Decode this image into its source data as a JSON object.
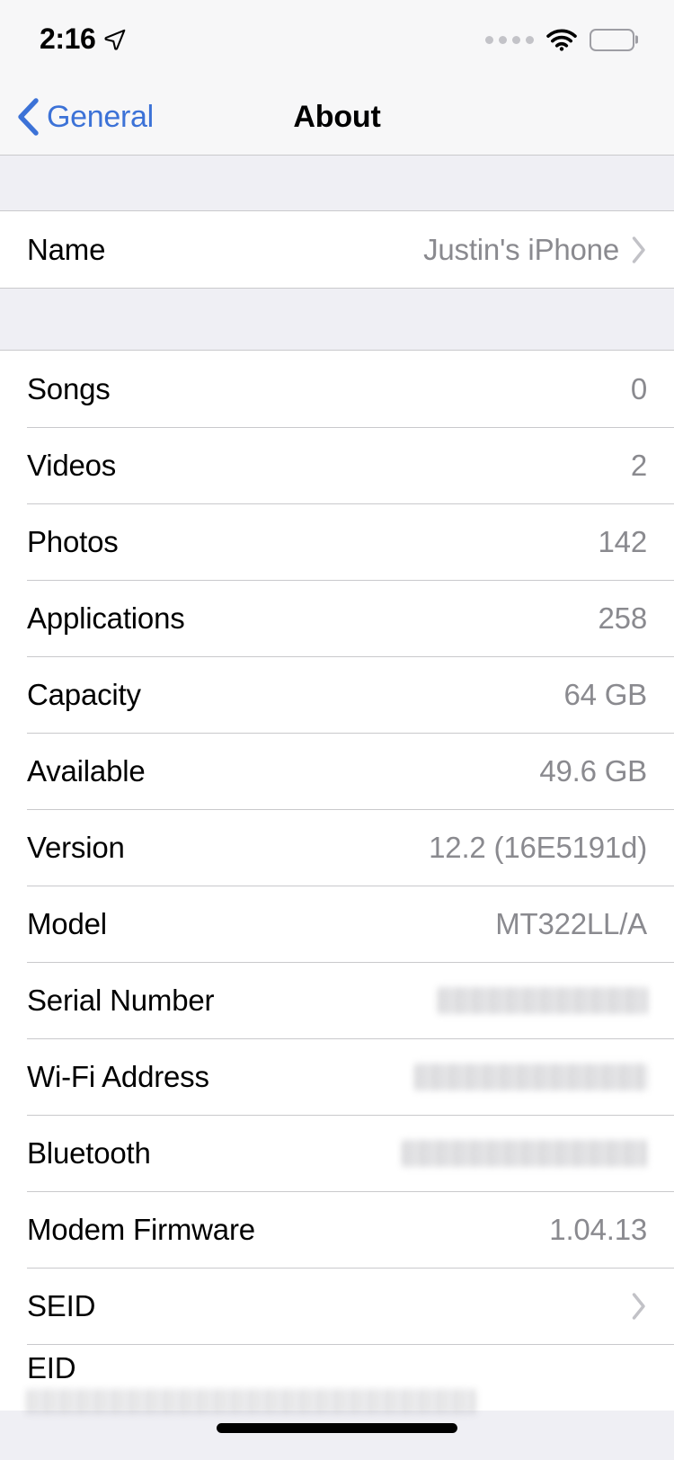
{
  "status_bar": {
    "time": "2:16",
    "location_icon": "location-arrow-icon",
    "signal_icon": "signal-dots-icon",
    "wifi_icon": "wifi-icon",
    "battery_icon": "battery-low-power-icon",
    "battery_color": "#F8CF47"
  },
  "nav": {
    "back_label": "General",
    "title": "About",
    "accent_color": "#3C72D7"
  },
  "sections": [
    {
      "rows": [
        {
          "label": "Name",
          "value": "Justin's iPhone",
          "chevron": true
        }
      ]
    },
    {
      "rows": [
        {
          "label": "Songs",
          "value": "0"
        },
        {
          "label": "Videos",
          "value": "2"
        },
        {
          "label": "Photos",
          "value": "142"
        },
        {
          "label": "Applications",
          "value": "258"
        },
        {
          "label": "Capacity",
          "value": "64 GB"
        },
        {
          "label": "Available",
          "value": "49.6 GB"
        },
        {
          "label": "Version",
          "value": "12.2 (16E5191d)"
        },
        {
          "label": "Model",
          "value": "MT322LL/A"
        },
        {
          "label": "Serial Number",
          "value": "",
          "redacted": true
        },
        {
          "label": "Wi-Fi Address",
          "value": "",
          "redacted": true
        },
        {
          "label": "Bluetooth",
          "value": "",
          "redacted": true
        },
        {
          "label": "Modem Firmware",
          "value": "1.04.13"
        },
        {
          "label": "SEID",
          "value": "",
          "chevron": true
        },
        {
          "label": "EID",
          "value": "",
          "redacted": true
        }
      ]
    }
  ],
  "rows": {
    "name": {
      "label": "Name",
      "value": "Justin's iPhone"
    },
    "songs": {
      "label": "Songs",
      "value": "0"
    },
    "videos": {
      "label": "Videos",
      "value": "2"
    },
    "photos": {
      "label": "Photos",
      "value": "142"
    },
    "applications": {
      "label": "Applications",
      "value": "258"
    },
    "capacity": {
      "label": "Capacity",
      "value": "64 GB"
    },
    "available": {
      "label": "Available",
      "value": "49.6 GB"
    },
    "version": {
      "label": "Version",
      "value": "12.2 (16E5191d)"
    },
    "model": {
      "label": "Model",
      "value": "MT322LL/A"
    },
    "serial_number": {
      "label": "Serial Number"
    },
    "wifi_address": {
      "label": "Wi-Fi Address"
    },
    "bluetooth": {
      "label": "Bluetooth"
    },
    "modem_firmware": {
      "label": "Modem Firmware",
      "value": "1.04.13"
    },
    "seid": {
      "label": "SEID"
    },
    "eid": {
      "label": "EID"
    }
  },
  "colors": {
    "accent": "#3C72D7",
    "value_gray": "#8A8A8F",
    "group_bg": "#FFFFFF",
    "page_bg": "#EFEFF4",
    "separator": "#C9C9CC",
    "battery_yellow": "#F8CF47"
  }
}
